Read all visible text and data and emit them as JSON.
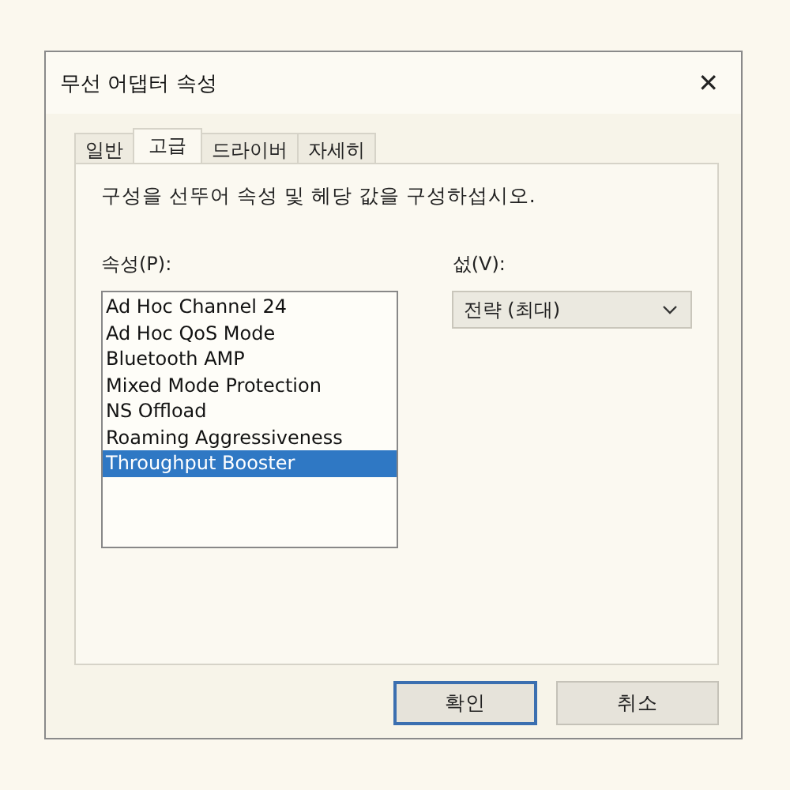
{
  "window": {
    "title": "무선 어댑터 속성",
    "close": "✕"
  },
  "tabs": [
    {
      "label": "일반",
      "selected": false
    },
    {
      "label": "고급",
      "selected": true
    },
    {
      "label": "드라이버",
      "selected": false
    },
    {
      "label": "자세히",
      "selected": false
    }
  ],
  "instruction": "구성을 선뚜어 속성 및 헤당 값을 구성하섭시오.",
  "property": {
    "label": "속성(P):",
    "items": [
      {
        "label": "Ad Hoc Channel 24",
        "selected": false
      },
      {
        "label": "Ad Hoc QoS Mode",
        "selected": false
      },
      {
        "label": "Bluetooth AMP",
        "selected": false
      },
      {
        "label": "Mixed Mode Protection",
        "selected": false
      },
      {
        "label": "NS Offload",
        "selected": false
      },
      {
        "label": "Roaming Aggressiveness",
        "selected": false
      },
      {
        "label": "Throughput Booster",
        "selected": true
      }
    ]
  },
  "value": {
    "label": "섮(V):",
    "selected": "전략 (최대)"
  },
  "buttons": [
    {
      "label": "확인",
      "default": true
    },
    {
      "label": "취소",
      "default": false
    }
  ]
}
